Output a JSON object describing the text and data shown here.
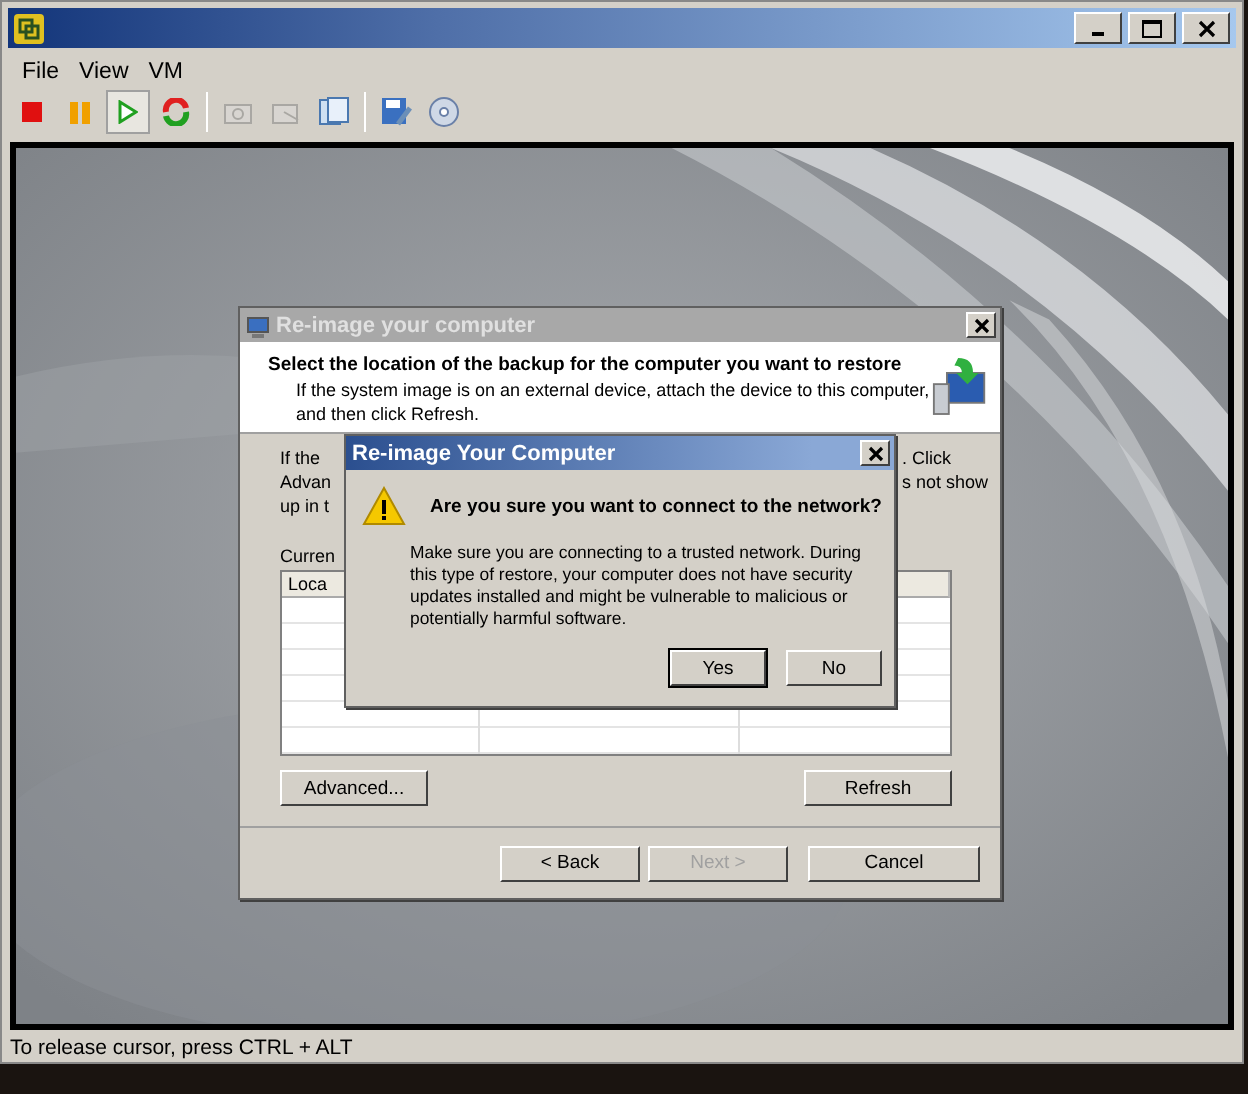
{
  "menu": [
    "File",
    "View",
    "VM"
  ],
  "toolbar": [
    {
      "kind": "stop",
      "selected": false,
      "disabled": false
    },
    {
      "kind": "pause",
      "selected": false,
      "disabled": false
    },
    {
      "kind": "play",
      "selected": true,
      "disabled": false
    },
    {
      "kind": "reset",
      "selected": false,
      "disabled": false
    },
    {
      "kind": "snapshot",
      "selected": false,
      "disabled": true
    },
    {
      "kind": "revert",
      "selected": false,
      "disabled": true
    },
    {
      "kind": "manage",
      "selected": false,
      "disabled": false
    },
    {
      "kind": "floppy",
      "selected": false,
      "disabled": false
    },
    {
      "kind": "disc",
      "selected": false,
      "disabled": false
    }
  ],
  "wizard": {
    "title": "Re-image your computer",
    "heading": "Select the location of the backup for the computer you want to restore",
    "subtext": [
      "If the system image is on an external device, attach the device to this computer,",
      "and then click Refresh."
    ],
    "intro_left": [
      "If the",
      "Advan",
      "up in t"
    ],
    "intro_right": [
      ". Click",
      "s not show"
    ],
    "table_label": "Curren",
    "columns": [
      "Loca"
    ],
    "buttons": [
      {
        "label": "Advanced..."
      },
      {
        "label": "Refresh"
      }
    ],
    "nav": [
      {
        "label": "< Back",
        "disabled": false
      },
      {
        "label": "Next >",
        "disabled": true
      },
      {
        "label": "Cancel",
        "disabled": false
      }
    ]
  },
  "message_box": {
    "title": "Re-image Your Computer",
    "question": "Are you sure you want to connect to the network?",
    "body": [
      "Make sure you are connecting to a trusted network. During",
      "this type of restore, your computer does not have security",
      "updates installed and might be vulnerable to malicious or",
      "potentially harmful software."
    ],
    "buttons": [
      {
        "label": "Yes",
        "default": true
      },
      {
        "label": "No",
        "default": false
      }
    ]
  },
  "status_bar": "To release cursor, press CTRL + ALT"
}
